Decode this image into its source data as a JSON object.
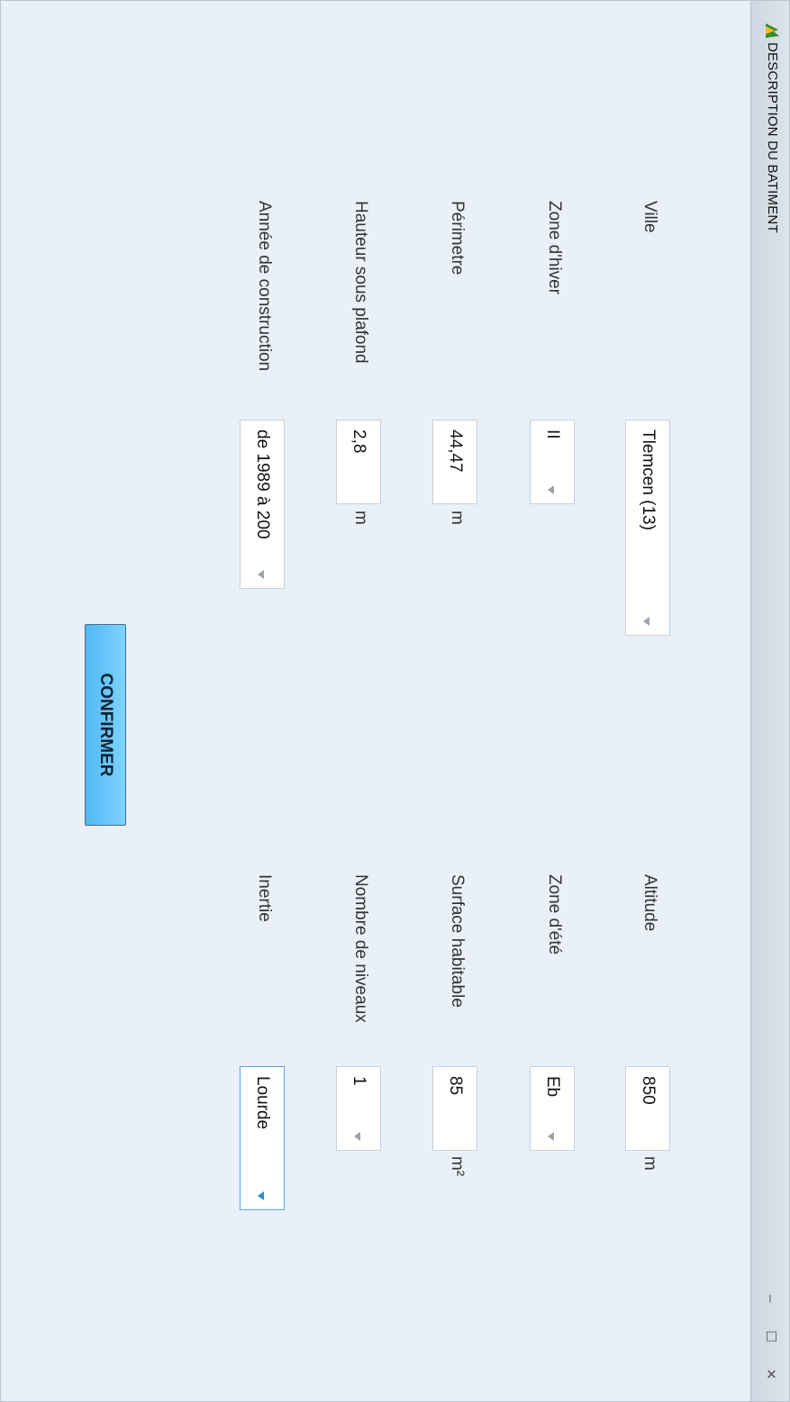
{
  "window": {
    "title": "DESCRIPTION DU BATIMENT",
    "controls": {
      "minimize": "–",
      "maximize": "☐",
      "close": "✕"
    },
    "app_icon": "app-logo-icon"
  },
  "form": {
    "ville": {
      "label": "Ville",
      "value": "Tlemcen (13)"
    },
    "zone_hiver": {
      "label": "Zone d'hiver",
      "value": "II"
    },
    "perimetre": {
      "label": "Périmetre",
      "value": "44,47",
      "unit": "m"
    },
    "hauteur": {
      "label": "Hauteur sous plafond",
      "value": "2,8",
      "unit": "m"
    },
    "annee": {
      "label": "Année de construction",
      "value": "de 1989 à 200"
    },
    "altitude": {
      "label": "Altitude",
      "value": "850",
      "unit": "m"
    },
    "zone_ete": {
      "label": "Zone d'été",
      "value": "Eb"
    },
    "surface": {
      "label": "Surface habitable",
      "value": "85",
      "unit": "m²"
    },
    "niveaux": {
      "label": "Nombre de niveaux",
      "value": "1"
    },
    "inertie": {
      "label": "Inertie",
      "value": "Lourde"
    }
  },
  "buttons": {
    "confirm": "CONFIRMER"
  },
  "colors": {
    "background": "#e9f0f7",
    "button": "#5cc0f7",
    "accent": "#2a8fd8"
  }
}
